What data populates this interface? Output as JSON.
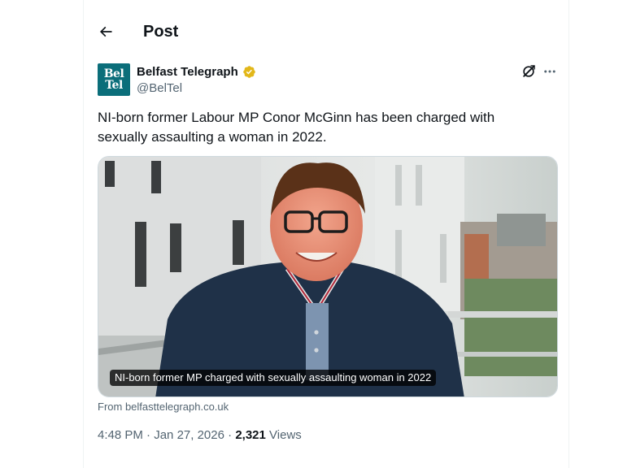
{
  "header": {
    "title": "Post",
    "back_icon": "arrow-left-icon"
  },
  "author": {
    "display_name": "Belfast Telegraph",
    "handle": "@BelTel",
    "avatar_line1": "Bel",
    "avatar_line2": "Tel",
    "avatar_color": "#0b6e7a",
    "verified_badge": "gold-verified-icon",
    "verified_color": "#e2b719"
  },
  "actions": {
    "grok_icon": "grok-icon",
    "more_icon": "more-horizontal-icon"
  },
  "tweet": {
    "text": "NI-born former Labour MP Conor McGinn has been charged with sexually assaulting a woman in 2022."
  },
  "card": {
    "caption": "NI-born former MP charged with sexually assaulting woman in 2022",
    "source": "From belfasttelegraph.co.uk"
  },
  "meta": {
    "time": "4:48 PM",
    "date": "Jan 27, 2026",
    "separator": "·",
    "views_count": "2,321",
    "views_label": "Views"
  },
  "colors": {
    "text_primary": "#0f1419",
    "text_secondary": "#536471",
    "border": "#cfd9de"
  }
}
